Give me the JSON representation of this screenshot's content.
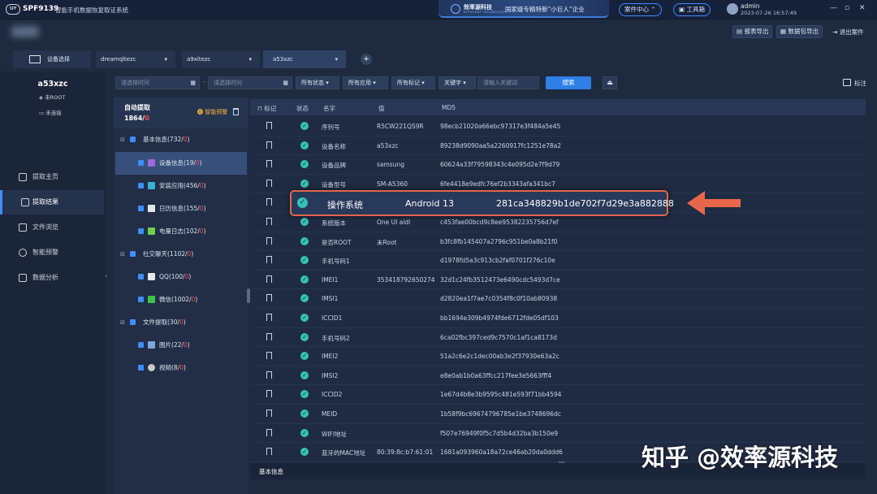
{
  "titlebar": {
    "logo": "SPF",
    "app_name": "SPF9139",
    "app_sub": "智能手机数据恢复取证系统",
    "banner_brand": "效率源科技",
    "banner_brand_sub": "EFFICIENT TECHNOLOGY",
    "banner_slogan": "国家级专精特新“小巨人”企业",
    "case_center": "案件中心",
    "toolbox": "工具箱",
    "user_name": "admin",
    "user_time": "2023-07-26 16:57:49",
    "win_min": "—",
    "win_max": "▫",
    "win_close": "✕"
  },
  "toolbar": {
    "report_export": "报表导出",
    "data_export": "数据包导出",
    "exit_case": "退出案件"
  },
  "tabs": {
    "device_select": "设备选择",
    "items": [
      {
        "label": "dreamqltezc"
      },
      {
        "label": "a9xltezc"
      },
      {
        "label": "a53xzc"
      }
    ],
    "caret": "▾",
    "add": "+"
  },
  "device": {
    "name": "a53xzc",
    "root_status": "未ROOT",
    "sim_status": "未连接"
  },
  "nav": [
    {
      "label": "提取主页"
    },
    {
      "label": "提取结果"
    },
    {
      "label": "文件浏览"
    },
    {
      "label": "智能预警"
    },
    {
      "label": "数据分析"
    }
  ],
  "filters": {
    "start_time": "请选择时间",
    "end_time": "请选择时间",
    "status": "所有状态 ▾",
    "app": "所有应用 ▾",
    "mark": "所有标记 ▾",
    "keyword": "关键字 ▾",
    "keyword_placeholder": "请输入关键词",
    "search": "搜索",
    "upload": "⏏",
    "mark_label": "标注"
  },
  "tree": {
    "title": "自动提取",
    "count_total": "1864",
    "count_sep": "/",
    "count_red": "0",
    "smart_warning": "智能预警",
    "rows": [
      {
        "name": "基本信息",
        "count": "(732/",
        "red": "0",
        "close": ")"
      },
      {
        "name": "设备信息",
        "count": "(19/",
        "red": "0",
        "close": ")"
      },
      {
        "name": "安装应用",
        "count": "(456/",
        "red": "0",
        "close": ")"
      },
      {
        "name": "日历信息",
        "count": "(155/",
        "red": "0",
        "close": ")"
      },
      {
        "name": "电量日志",
        "count": "(102/",
        "red": "0",
        "close": ")"
      },
      {
        "name": "社交聊天",
        "count": "(1102/",
        "red": "0",
        "close": ")"
      },
      {
        "name": "QQ",
        "count": "(100/",
        "red": "0",
        "close": ")"
      },
      {
        "name": "微信",
        "count": "(1002/",
        "red": "0",
        "close": ")"
      },
      {
        "name": "文件提取",
        "count": "(30/",
        "red": "0",
        "close": ")"
      },
      {
        "name": "图片",
        "count": "(22/",
        "red": "0",
        "close": ")"
      },
      {
        "name": "视频",
        "count": "(8/",
        "red": "0",
        "close": ")"
      }
    ]
  },
  "table": {
    "headers": {
      "mark": "标记",
      "status": "状态",
      "name": "名字",
      "value": "值",
      "md5": "MD5"
    },
    "rows": [
      {
        "name": "序列号",
        "value": "R5CW221QS9R",
        "md5": "98ecb21020a66ebc97317e3f484a5e45"
      },
      {
        "name": "设备名称",
        "value": "a53xzc",
        "md5": "89238d9090aa5a2260917fc1251e78a2"
      },
      {
        "name": "设备品牌",
        "value": "samsung",
        "md5": "60624a33f79598343c4e095d2e7f9d79"
      },
      {
        "name": "设备型号",
        "value": "SM-A5360",
        "md5": "6fe4418e9edfc76ef2b3343afa341bc7"
      },
      {
        "name": "操作系统",
        "value": "Android 13",
        "md5": "281ca348829b1de702f7d29e3a882888"
      },
      {
        "name": "系统版本",
        "value": "One UI aidl",
        "md5": "c453fae00bcd9c8ee95382235756d7ef"
      },
      {
        "name": "是否ROOT",
        "value": "未Root",
        "md5": "b3fc8fb145407a2796c951be0a8b21f0"
      },
      {
        "name": "手机号码1",
        "value": "",
        "md5": "d1978fd5a3c913cb2faf0701f276c10e"
      },
      {
        "name": "IMEI1",
        "value": "353418792650274",
        "md5": "32d1c24fb3512473e6490cdc5493d7ce"
      },
      {
        "name": "IMSI1",
        "value": "",
        "md5": "d2820ea1f7ae7c0354f8c0f10ab80938"
      },
      {
        "name": "ICCID1",
        "value": "",
        "md5": "bb1694e309b4974fde6712fde05df103"
      },
      {
        "name": "手机号码2",
        "value": "",
        "md5": "6ca02fbc397ced9c7570c1af1ca8173d"
      },
      {
        "name": "IMEI2",
        "value": "",
        "md5": "51a2c6e2c1dec00ab3e2f37930e63a2c"
      },
      {
        "name": "IMSI2",
        "value": "",
        "md5": "e8e0ab1b0a63ffcc217fee3e5663fff4"
      },
      {
        "name": "ICCID2",
        "value": "",
        "md5": "1e67d4b8e3b9595c481e593f71bb4594"
      },
      {
        "name": "MEID",
        "value": "",
        "md5": "1b58f9bc69674796785e1be3748696dc"
      },
      {
        "name": "WIFI地址",
        "value": "",
        "md5": "f507e76949f0f5c7d5b4d32ba3b150e9"
      },
      {
        "name": "蓝牙的MAC地址",
        "value": "80:39:8c:b7:61:01",
        "md5": "1681a093960a18a72ce46ab20da0ddd6"
      }
    ],
    "bottom_tab": "基本信息"
  },
  "watermark": "知乎 @效率源科技",
  "colors": {
    "accent": "#3f8cff",
    "highlight_border": "#e0664a",
    "arrow": "#e8674a",
    "status_ok": "#34c3b4"
  }
}
